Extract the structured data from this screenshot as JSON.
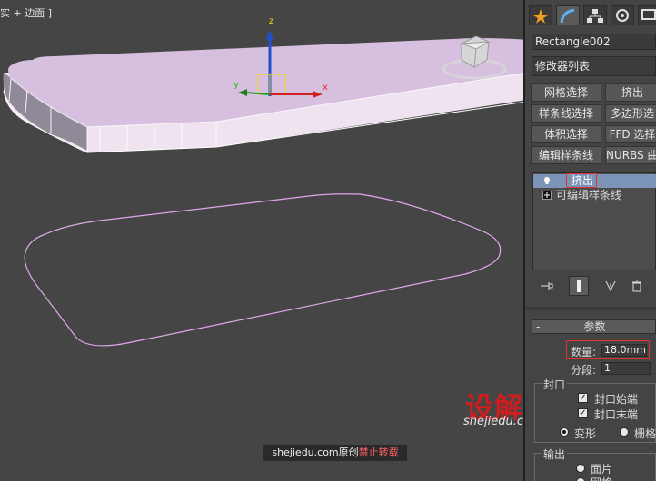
{
  "viewport": {
    "label": "实 + 边面 ]",
    "gizmo": {
      "x_label": "x",
      "y_label": "y",
      "z_label": "z"
    },
    "watermark": {
      "logo": "设解读",
      "url": "shejiedu.com"
    },
    "source": {
      "text": "shejiedu.com原创",
      "warning": "禁止转载"
    }
  },
  "panel": {
    "object_name": "Rectangle002",
    "modifier_list": "修改器列表",
    "buttons": [
      {
        "label": "网格选择"
      },
      {
        "label": "挤出"
      },
      {
        "label": "样条线选择"
      },
      {
        "label": "多边形选"
      },
      {
        "label": "体积选择"
      },
      {
        "label": "FFD 选择"
      },
      {
        "label": "编辑样条线"
      },
      {
        "label": "NURBS 曲面"
      }
    ],
    "stack": [
      {
        "label": "挤出",
        "selected": true,
        "icon": "bulb-icon"
      },
      {
        "label": "可编辑样条线",
        "selected": false,
        "icon": "expand-plus-icon"
      }
    ],
    "params": {
      "title": "参数",
      "amount_label": "数量:",
      "amount_value": "18.0mm",
      "segments_label": "分段:",
      "segments_value": "1",
      "cap_group": "封口",
      "cap_start": "封口始端",
      "cap_end": "封口末端",
      "morph": "变形",
      "grid": "栅格",
      "output_group": "输出",
      "patch": "面片",
      "mesh": "网格"
    },
    "colors": {
      "selection": "#7b94b8",
      "highlight": "#e03030"
    }
  }
}
